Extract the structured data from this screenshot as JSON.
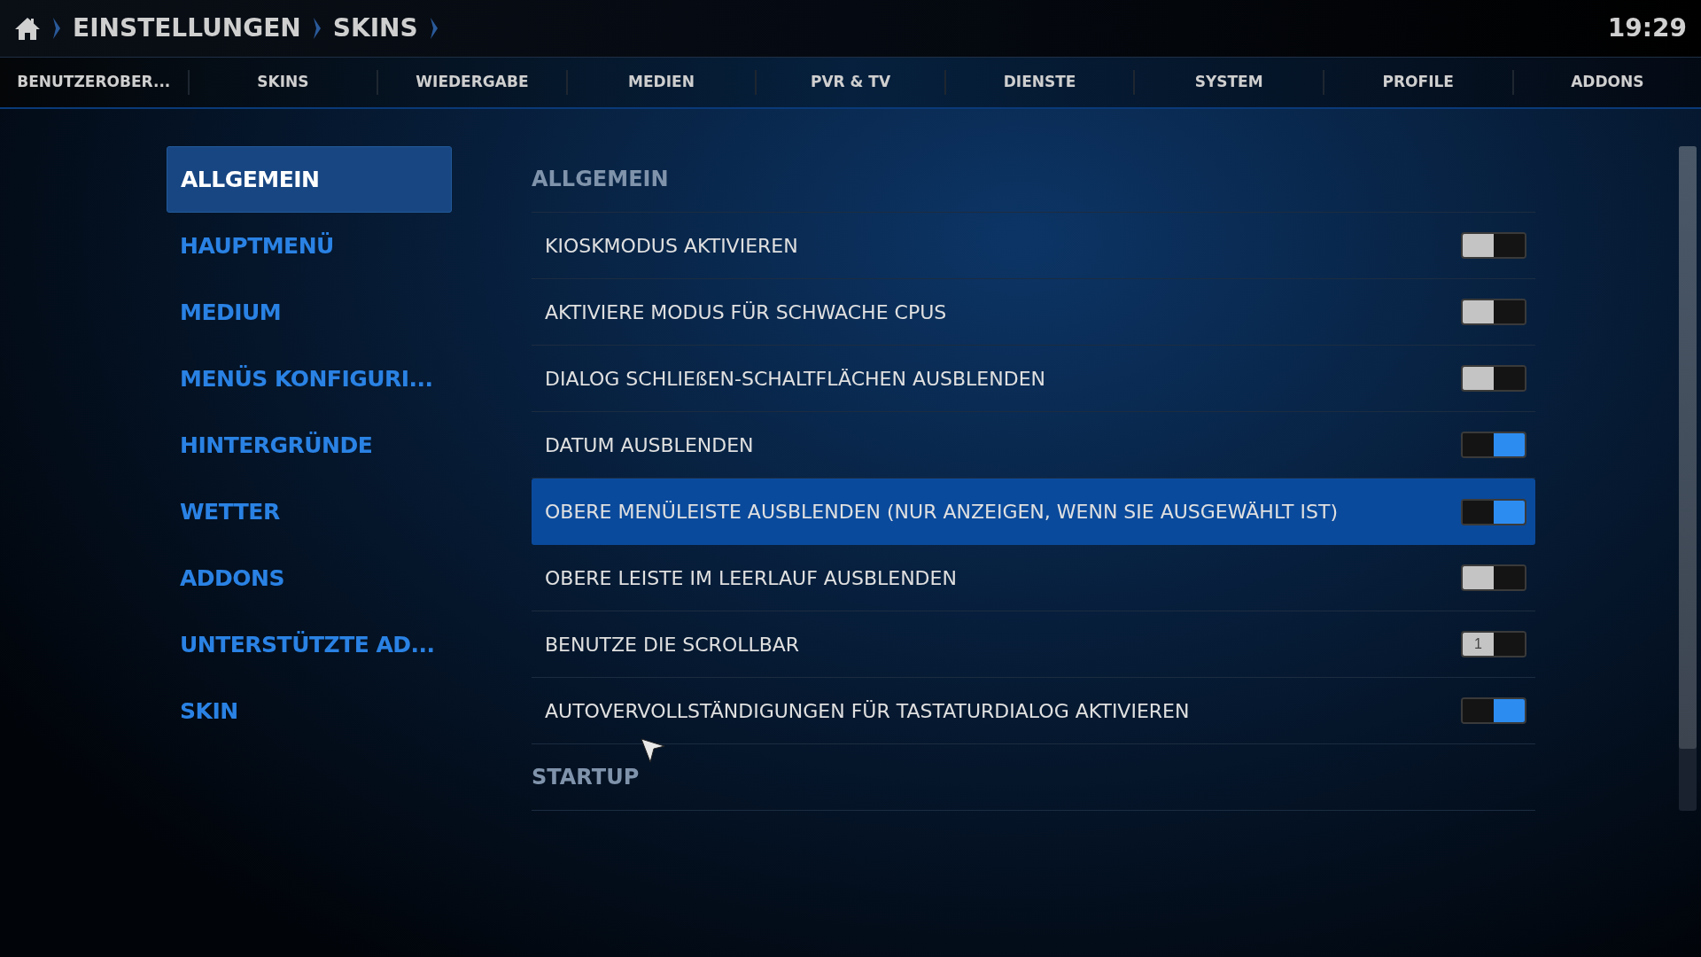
{
  "breadcrumb": [
    "EINSTELLUNGEN",
    "SKINS"
  ],
  "clock": "19:29",
  "tabs": [
    {
      "label": "BENUTZEROBER..."
    },
    {
      "label": "SKINS"
    },
    {
      "label": "WIEDERGABE"
    },
    {
      "label": "MEDIEN"
    },
    {
      "label": "PVR & TV"
    },
    {
      "label": "DIENSTE"
    },
    {
      "label": "SYSTEM"
    },
    {
      "label": "PROFILE"
    },
    {
      "label": "ADDONS"
    }
  ],
  "sidebar": {
    "items": [
      {
        "label": "ALLGEMEIN",
        "selected": true
      },
      {
        "label": "HAUPTMENÜ",
        "selected": false
      },
      {
        "label": "MEDIUM",
        "selected": false
      },
      {
        "label": "MENÜS KONFIGURI...",
        "selected": false
      },
      {
        "label": "HINTERGRÜNDE",
        "selected": false
      },
      {
        "label": "WETTER",
        "selected": false
      },
      {
        "label": "ADDONS",
        "selected": false
      },
      {
        "label": "UNTERSTÜTZTE AD...",
        "selected": false
      },
      {
        "label": "SKIN",
        "selected": false
      }
    ]
  },
  "settings": [
    {
      "kind": "header",
      "label": "ALLGEMEIN"
    },
    {
      "kind": "toggle",
      "label": "KIOSKMODUS AKTIVIEREN",
      "on": false,
      "selected": false
    },
    {
      "kind": "toggle",
      "label": "AKTIVIERE MODUS FÜR SCHWACHE CPUS",
      "on": false,
      "selected": false
    },
    {
      "kind": "toggle",
      "label": "DIALOG SCHLIEßEN-SCHALTFLÄCHEN AUSBLENDEN",
      "on": false,
      "selected": false
    },
    {
      "kind": "toggle",
      "label": "DATUM AUSBLENDEN",
      "on": true,
      "selected": false
    },
    {
      "kind": "toggle",
      "label": "OBERE MENÜLEISTE AUSBLENDEN (NUR ANZEIGEN, WENN SIE AUSGEWÄHLT IST)",
      "on": true,
      "selected": true
    },
    {
      "kind": "toggle",
      "label": "OBERE LEISTE IM LEERLAUF AUSBLENDEN",
      "on": false,
      "selected": false
    },
    {
      "kind": "toggle",
      "label": "BENUTZE DIE SCROLLBAR",
      "on": false,
      "selected": false,
      "knob_text": "1"
    },
    {
      "kind": "toggle",
      "label": "AUTOVERVOLLSTÄNDIGUNGEN FÜR TASTATURDIALOG AKTIVIEREN",
      "on": true,
      "selected": false
    },
    {
      "kind": "header",
      "label": "STARTUP"
    }
  ]
}
